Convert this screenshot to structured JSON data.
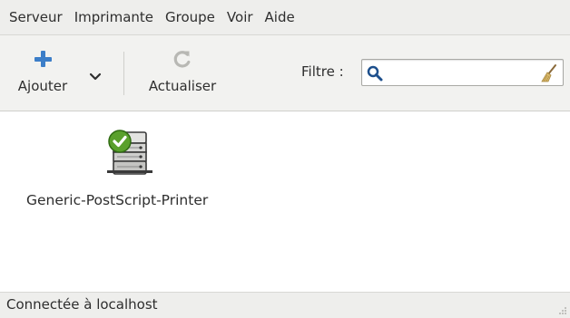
{
  "menubar": {
    "items": [
      {
        "label": "Serveur"
      },
      {
        "label": "Imprimante"
      },
      {
        "label": "Groupe"
      },
      {
        "label": "Voir"
      },
      {
        "label": "Aide"
      }
    ]
  },
  "toolbar": {
    "add_label": "Ajouter",
    "add_icon": "plus-icon",
    "refresh_label": "Actualiser",
    "refresh_icon": "refresh-icon",
    "filter_label": "Filtre :",
    "filter_value": "",
    "accent_color": "#3c7ec8"
  },
  "printers": [
    {
      "name": "Generic-PostScript-Printer",
      "status_icon": "check-badge-icon"
    }
  ],
  "statusbar": {
    "text": "Connectée à localhost"
  }
}
